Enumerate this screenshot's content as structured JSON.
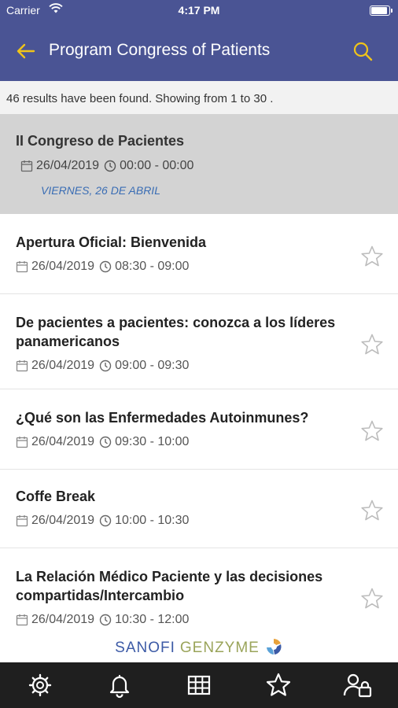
{
  "status_bar": {
    "carrier": "Carrier",
    "time": "4:17 PM"
  },
  "header": {
    "title": "Program Congress of Patients",
    "back_icon": "arrow-left-icon",
    "search_icon": "search-icon"
  },
  "results_text": "46 results have been found. Showing from 1 to 30 .",
  "section": {
    "title": "II Congreso de Pacientes",
    "date": "26/04/2019",
    "time": "00:00 - 00:00",
    "day_label": "VIERNES, 26 DE ABRIL"
  },
  "sessions": [
    {
      "title": "Apertura Oficial: Bienvenida",
      "date": "26/04/2019",
      "time": "08:30 - 09:00"
    },
    {
      "title": "De pacientes a pacientes: conozca a los líderes panamericanos",
      "date": "26/04/2019",
      "time": "09:00 - 09:30"
    },
    {
      "title": "¿Qué son las Enfermedades Autoinmunes?",
      "date": "26/04/2019",
      "time": "09:30 - 10:00"
    },
    {
      "title": "Coffe Break",
      "date": "26/04/2019",
      "time": "10:00 - 10:30"
    },
    {
      "title": "La Relación Médico Paciente y las decisiones compartidas/Intercambio",
      "date": "26/04/2019",
      "time": "10:30 - 12:00"
    }
  ],
  "sponsor": {
    "name_part1": "SANOFI",
    "name_part2": "GENZYME"
  },
  "tab_bar": [
    "gear-icon",
    "bell-icon",
    "grid-icon",
    "star-icon",
    "user-lock-icon"
  ],
  "colors": {
    "header": "#4a5494",
    "accent": "#f0c419",
    "day_label": "#3a6db4",
    "tabbar": "#1f1f1f"
  }
}
